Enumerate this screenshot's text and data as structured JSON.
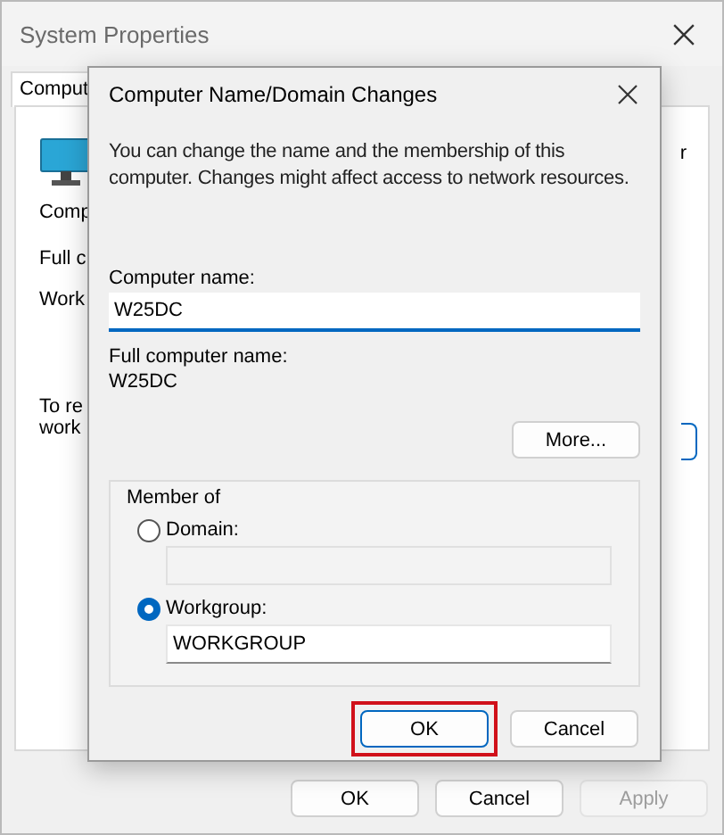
{
  "window": {
    "title": "System Properties"
  },
  "tabs": [
    {
      "label": "Comput",
      "selected": true
    }
  ],
  "background_panel": {
    "texts": [
      "Comp",
      "Full c",
      "Work"
    ],
    "note_lines": [
      "To re",
      "work"
    ],
    "side_text": "r"
  },
  "dialog": {
    "title": "Computer Name/Domain Changes",
    "description": "You can change the name and the membership of this computer. Changes might affect access to network resources.",
    "computer_name": {
      "label": "Computer name:",
      "value": "W25DC"
    },
    "full_name": {
      "label": "Full computer name:",
      "value": "W25DC"
    },
    "more_button": "More...",
    "member_of": {
      "label": "Member of",
      "options": [
        {
          "label": "Domain:",
          "selected": false,
          "disabled": true
        },
        {
          "label": "Workgroup:",
          "selected": true,
          "value": "WORKGROUP",
          "disabled": false
        }
      ]
    },
    "buttons": [
      {
        "label": "OK",
        "default": true,
        "highlighted": true
      },
      {
        "label": "Cancel",
        "default": false,
        "highlighted": false
      }
    ]
  },
  "buttons": [
    {
      "label": "OK",
      "disabled": false
    },
    {
      "label": "Cancel",
      "disabled": false
    },
    {
      "label": "Apply",
      "disabled": true
    }
  ]
}
